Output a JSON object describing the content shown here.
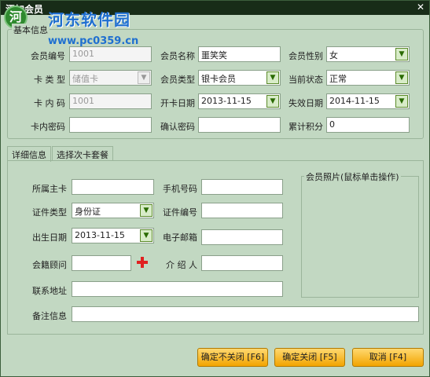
{
  "window": {
    "title": "添加会员",
    "close_glyph": "✕"
  },
  "watermark": {
    "logo_text": "河",
    "title": "河东软件园",
    "url": "www.pc0359.cn"
  },
  "basic": {
    "legend": "基本信息",
    "member_no": {
      "label": "会员编号",
      "value": "1001"
    },
    "member_name": {
      "label": "会员名称",
      "value": "噩笑笑"
    },
    "gender": {
      "label": "会员性别",
      "value": "女"
    },
    "card_type": {
      "label": "卡 类 型",
      "value": "储值卡"
    },
    "member_type": {
      "label": "会员类型",
      "value": "银卡会员"
    },
    "status": {
      "label": "当前状态",
      "value": "正常"
    },
    "card_code": {
      "label": "卡 内 码",
      "value": "1001"
    },
    "open_date": {
      "label": "开卡日期",
      "value": "2013-11-15"
    },
    "expire_date": {
      "label": "失效日期",
      "value": "2014-11-15"
    },
    "card_password": {
      "label": "卡内密码",
      "value": ""
    },
    "confirm_password": {
      "label": "确认密码",
      "value": ""
    },
    "points": {
      "label": "累计积分",
      "value": "0"
    }
  },
  "tabs": [
    "详细信息",
    "选择次卡套餐"
  ],
  "detail": {
    "main_card": {
      "label": "所属主卡",
      "value": ""
    },
    "mobile": {
      "label": "手机号码",
      "value": ""
    },
    "id_type": {
      "label": "证件类型",
      "value": "身份证"
    },
    "id_no": {
      "label": "证件编号",
      "value": ""
    },
    "birth_date": {
      "label": "出生日期",
      "value": "2013-11-15"
    },
    "email": {
      "label": "电子邮箱",
      "value": ""
    },
    "advisor": {
      "label": "会籍顾问",
      "value": ""
    },
    "introducer": {
      "label": "介 绍 人",
      "value": ""
    },
    "address": {
      "label": "联系地址",
      "value": ""
    },
    "remark": {
      "label": "备注信息",
      "value": ""
    },
    "photo_legend": "会员照片(鼠标单击操作)"
  },
  "buttons": {
    "confirm_keep": "确定不关闭 [F6]",
    "confirm_close": "确定关闭 [F5]",
    "cancel": "取消 [F4]"
  },
  "colors": {
    "dialog_bg": "#c2d8c2",
    "titlebar_bg": "#182c18",
    "button_gradient": "#f2a400",
    "plus_icon": "#e02020",
    "watermark": "#1f6fd0"
  },
  "icons": {
    "dropdown": "chevron-down-icon",
    "add": "plus-icon",
    "close": "close-icon"
  }
}
